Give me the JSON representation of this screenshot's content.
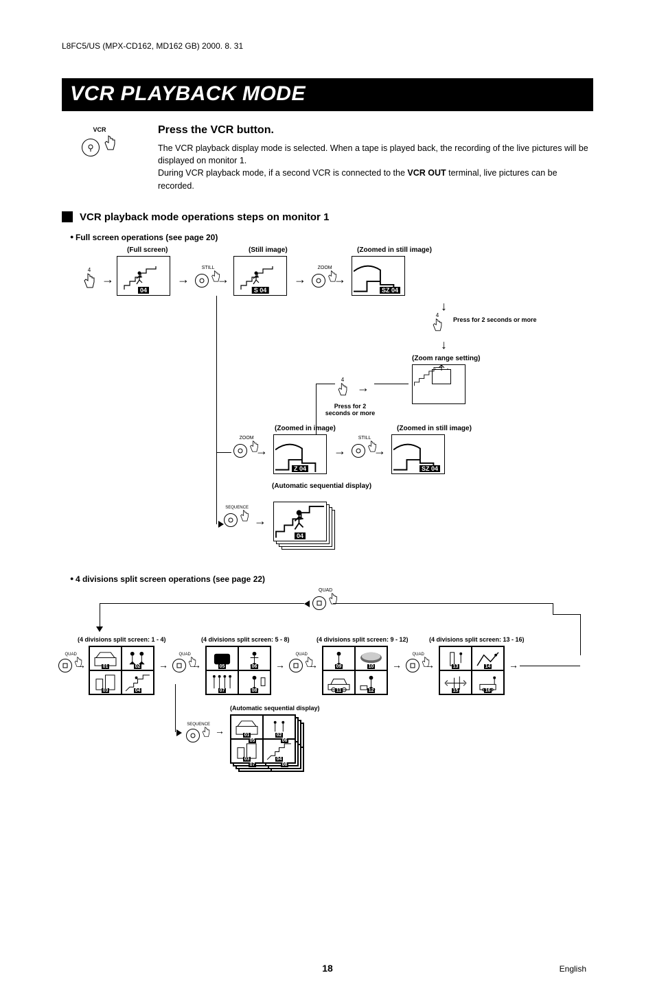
{
  "header_note": "L8FC5/US (MPX-CD162, MD162 GB) 2000. 8. 31",
  "title": "VCR PLAYBACK MODE",
  "vcr_label": "VCR",
  "intro": {
    "heading": "Press the VCR button.",
    "line1": "The VCR playback display mode is selected. When a tape is played back, the recording of the live pictures will be displayed on monitor 1.",
    "line2a": "During VCR playback mode, if a second VCR is connected to the ",
    "line2b": "VCR OUT",
    "line2c": " terminal, live pictures can be recorded."
  },
  "section_title": "VCR playback mode operations steps on monitor 1",
  "bullet1": "Full screen operations (see page 20)",
  "captions": {
    "full": "(Full screen)",
    "still": "(Still image)",
    "zoomed_still": "(Zoomed in still image)",
    "zoom_range": "(Zoom range setting)",
    "zoomed": "(Zoomed in image)",
    "auto_seq": "(Automatic sequential display)",
    "press2": "Press for 2 seconds or more",
    "quad1": "(4 divisions split screen: 1 - 4)",
    "quad2": "(4 divisions split screen: 5 - 8)",
    "quad3": "(4 divisions split screen: 9 - 12)",
    "quad4": "(4 divisions split screen: 13 - 16)"
  },
  "btn_labels": {
    "num4": "4",
    "still": "STILL",
    "zoom": "ZOOM",
    "sequence": "SEQUENCE",
    "quad": "QUAD"
  },
  "thumb_labels": {
    "t04": "04",
    "s04": "S  04",
    "sz04": "SZ  04",
    "z04": "Z  04"
  },
  "quad_cells": {
    "g1": [
      "01",
      "02",
      "03",
      "04"
    ],
    "g2": [
      "05",
      "06",
      "07",
      "08"
    ],
    "g3": [
      "09",
      "10",
      "11",
      "12"
    ],
    "g4": [
      "13",
      "14",
      "15",
      "16"
    ],
    "seq": [
      "01",
      "02",
      "03",
      "04",
      "05",
      "06",
      "07",
      "08"
    ]
  },
  "bullet2": "4 divisions split screen operations (see page 22)",
  "page_number": "18",
  "lang": "English"
}
